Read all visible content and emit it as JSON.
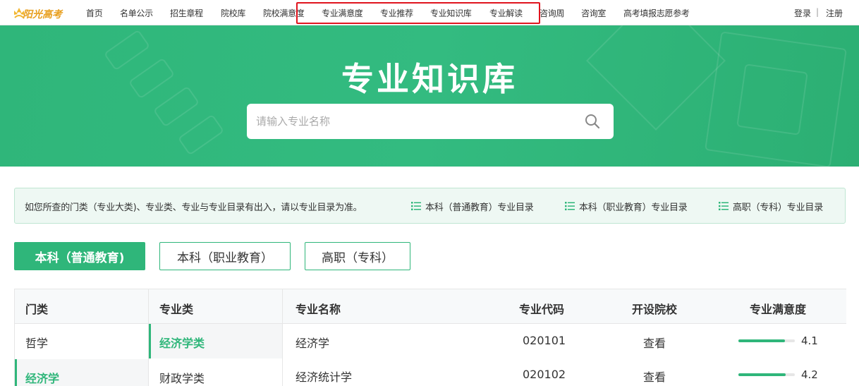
{
  "nav": {
    "logo_text": "阳光高考",
    "items": [
      "首页",
      "名单公示",
      "招生章程",
      "院校库",
      "院校满意度",
      "专业满意度",
      "专业推荐",
      "专业知识库",
      "专业解读",
      "咨询周",
      "咨询室",
      "高考填报志愿参考"
    ],
    "login": "登录",
    "separator": "|",
    "register": "注册"
  },
  "banner": {
    "title": "专业知识库",
    "search_placeholder": "请输入专业名称"
  },
  "notice": {
    "text": "如您所查的门类（专业大类)、专业类、专业与专业目录有出入，请以专业目录为准。",
    "links": [
      "本科（普通教育）专业目录",
      "本科（职业教育）专业目录",
      "高职（专科）专业目录"
    ]
  },
  "tabs": [
    "本科（普通教育)",
    "本科（职业教育）",
    "高职（专科）"
  ],
  "table": {
    "col1_header": "门类",
    "col2_header": "专业类",
    "headers": [
      "专业名称",
      "专业代码",
      "开设院校",
      "专业满意度"
    ],
    "categories": [
      "哲学",
      "经济学"
    ],
    "subcategories": [
      "经济学类",
      "财政学类"
    ],
    "rows": [
      {
        "name": "经济学",
        "code": "020101",
        "action": "查看",
        "score": "4.1",
        "pct": 0.82
      },
      {
        "name": "经济统计学",
        "code": "020102",
        "action": "查看",
        "score": "4.2",
        "pct": 0.84
      }
    ]
  },
  "colors": {
    "accent": "#2fb67a",
    "highlight": "#e0141e"
  }
}
